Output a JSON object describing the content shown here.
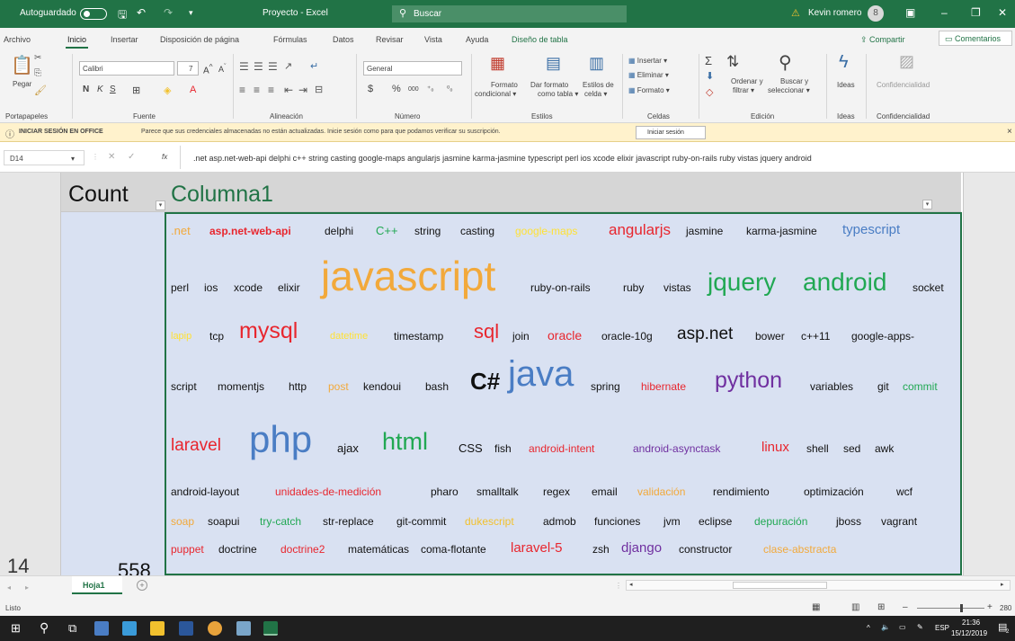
{
  "titlebar": {
    "autosave_label": "Autoguardado",
    "doc_title": "Proyecto - Excel",
    "search_placeholder": "Buscar",
    "warning_symbol": "⚠",
    "user_name": "Kevin romero",
    "user_initial": "8"
  },
  "menu": {
    "items": [
      "Archivo",
      "Inicio",
      "Insertar",
      "Disposición de página",
      "Fórmulas",
      "Datos",
      "Revisar",
      "Vista",
      "Ayuda",
      "Diseño de tabla"
    ],
    "share": "Compartir",
    "comments": "Comentarios"
  },
  "ribbon": {
    "paste": "Pegar",
    "font_name": "Calibri",
    "font_size": "7",
    "bold": "N",
    "italic": "K",
    "underline": "S",
    "number_format": "General",
    "currency": "$",
    "percent": "%",
    "thousands": "000",
    "cond_format": [
      "Formato",
      "condicional ▾"
    ],
    "table_format": [
      "Dar formato",
      "como tabla ▾"
    ],
    "cell_styles": [
      "Estilos de",
      "celda ▾"
    ],
    "insert": "Insertar",
    "delete": "Eliminar",
    "format": "Formato",
    "sort": [
      "Ordenar y",
      "filtrar ▾"
    ],
    "find": [
      "Buscar y",
      "seleccionar ▾"
    ],
    "ideas": "Ideas",
    "sensitivity": "Confidencialidad",
    "groups": [
      "Portapapeles",
      "Fuente",
      "Alineación",
      "Número",
      "Estilos",
      "Celdas",
      "Edición",
      "Ideas",
      "Confidencialidad"
    ]
  },
  "notification": {
    "title": "INICIAR SESIÓN EN OFFICE",
    "message": "Parece que sus credenciales almacenadas no están actualizadas. Inicie sesión como  para que podamos verificar su suscripción.",
    "button": "Iniciar sesión",
    "close": "×"
  },
  "formula_bar": {
    "name_box": "D14",
    "fx": "fx",
    "content": ".net asp.net-web-api delphi c++ string casting google-maps angularjs jasmine karma-jasmine typescript perl ios xcode elixir javascript ruby-on-rails ruby vistas jquery android"
  },
  "grid": {
    "header_count": "Count",
    "header_col": "Columna1",
    "row_number": "14",
    "count_value": "558"
  },
  "words": {
    "l1": [
      ".net",
      "asp.net-web-api",
      "delphi",
      "C++",
      "string",
      "casting",
      "google-maps",
      "angularjs",
      "jasmine",
      "karma-jasmine",
      "typescript"
    ],
    "l2": [
      "perl",
      "ios",
      "xcode",
      "elixir",
      "javascript",
      "ruby-on-rails",
      "ruby",
      "vistas",
      "jquery",
      "android",
      "socket"
    ],
    "l3": [
      "lapip",
      "tcp",
      "mysql",
      "datetime",
      "timestamp",
      "sql",
      "join",
      "oracle",
      "oracle-10g",
      "asp.net",
      "bower",
      "c++11",
      "google-apps-"
    ],
    "l4": [
      "script",
      "momentjs",
      "http",
      "post",
      "kendoui",
      "bash",
      "C#",
      "java",
      "spring",
      "hibernate",
      "python",
      "variables",
      "git",
      "commit"
    ],
    "l5": [
      "laravel",
      "php",
      "ajax",
      "html",
      "CSS",
      "fish",
      "android-intent",
      "android-asynctask",
      "linux",
      "shell",
      "sed",
      "awk"
    ],
    "l6": [
      "android-layout",
      "unidades-de-medición",
      "pharo",
      "smalltalk",
      "regex",
      "email",
      "validación",
      "rendimiento",
      "optimización",
      "wcf"
    ],
    "l7": [
      "soap",
      "soapui",
      "try-catch",
      "str-replace",
      "git-commit",
      "dukescript",
      "admob",
      "funciones",
      "jvm",
      "eclipse",
      "depuración",
      "jboss",
      "vagrant"
    ],
    "l8": [
      "puppet",
      "doctrine",
      "doctrine2",
      "matemáticas",
      "coma-flotante",
      "laravel-5",
      "zsh",
      "django",
      "constructor",
      "clase-abstracta"
    ]
  },
  "tabs": {
    "sheet": "Hoja1",
    "add": "+"
  },
  "status": {
    "ready": "Listo",
    "zoom": "280"
  },
  "taskbar": {
    "lang": "ESP",
    "time": "21:36",
    "date": "15/12/2019",
    "notify": "2"
  },
  "colors": {
    "excel_green": "#217346",
    "cell_fill": "#d9e1f2",
    "red": "#e8262e",
    "green": "#21a853",
    "blue": "#4a7dc4",
    "purple": "#7030a0",
    "orange": "#f2a93b",
    "yellow": "#ffe135",
    "black": "#111111"
  }
}
